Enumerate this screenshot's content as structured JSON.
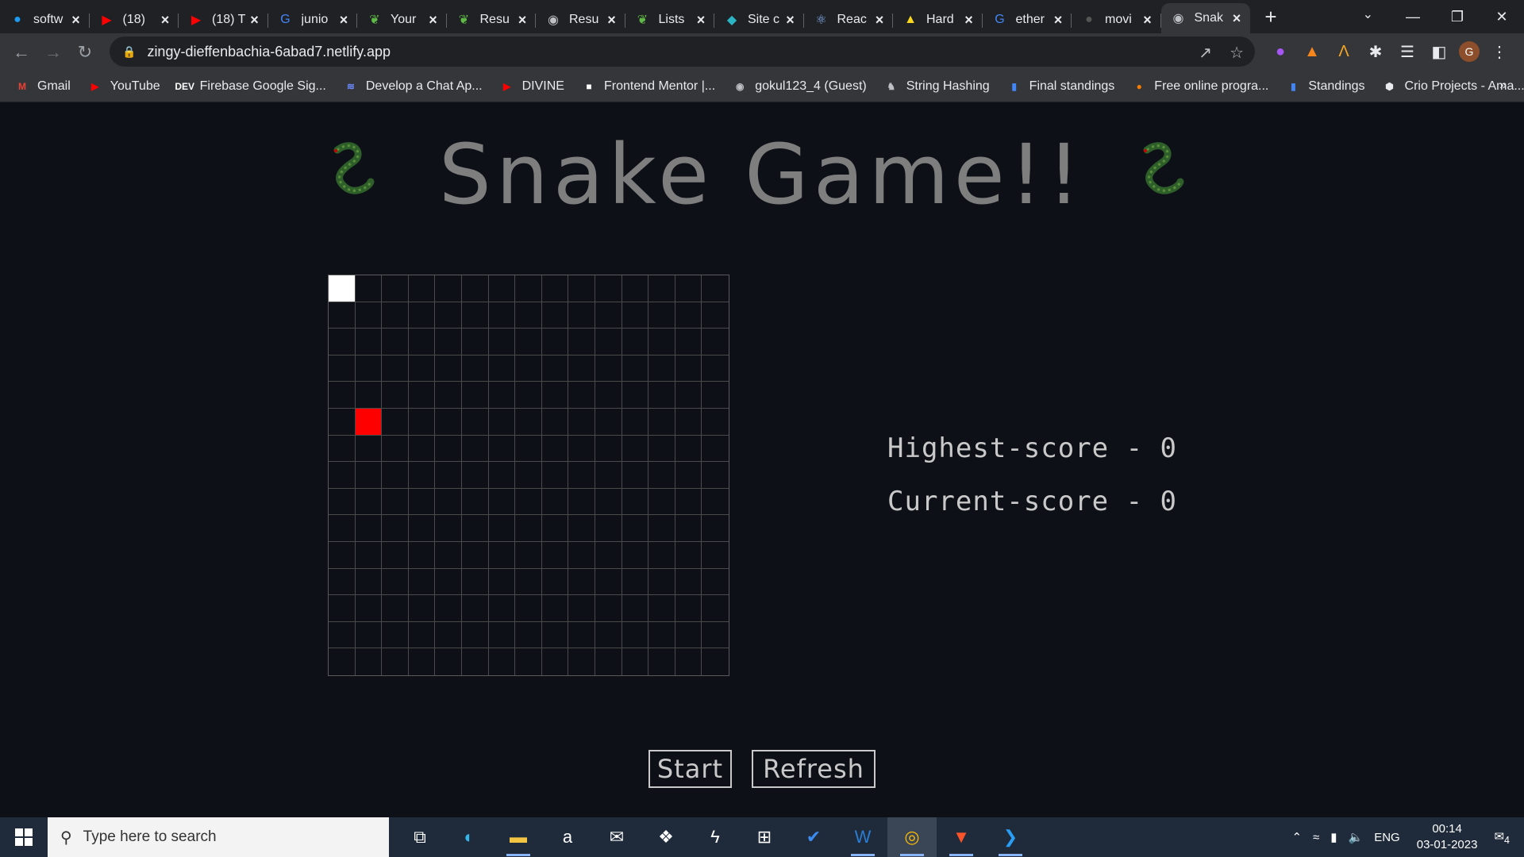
{
  "browser": {
    "tabs": [
      {
        "title": "softw",
        "icon": "twitter-icon"
      },
      {
        "title": "(18) ",
        "icon": "youtube-icon"
      },
      {
        "title": "(18) T",
        "icon": "youtube-icon"
      },
      {
        "title": "junio",
        "icon": "google-icon"
      },
      {
        "title": "Your",
        "icon": "leaf-icon"
      },
      {
        "title": "Resu",
        "icon": "leaf-icon"
      },
      {
        "title": "Resu",
        "icon": "globe-icon"
      },
      {
        "title": "Lists",
        "icon": "leaf-icon"
      },
      {
        "title": "Site c",
        "icon": "diamond-icon"
      },
      {
        "title": "Reac",
        "icon": "react-icon"
      },
      {
        "title": "Hard",
        "icon": "warning-icon"
      },
      {
        "title": "ether",
        "icon": "google-icon"
      },
      {
        "title": "movi",
        "icon": "github-icon"
      },
      {
        "title": "Snak",
        "icon": "globe-icon",
        "active": true
      }
    ],
    "url": "zingy-dieffenbachia-6abad7.netlify.app",
    "profile_initial": "G",
    "bookmarks": [
      {
        "label": "Gmail",
        "icon": "gmail-icon"
      },
      {
        "label": "YouTube",
        "icon": "youtube-icon"
      },
      {
        "label": "Firebase Google Sig...",
        "icon": "dev-icon"
      },
      {
        "label": "Develop a Chat Ap...",
        "icon": "stack-icon"
      },
      {
        "label": "DIVINE",
        "icon": "youtube-icon"
      },
      {
        "label": "Frontend Mentor |...",
        "icon": "frontend-mentor-icon"
      },
      {
        "label": "gokul123_4 (Guest)",
        "icon": "globe-icon"
      },
      {
        "label": "String Hashing",
        "icon": "owl-icon"
      },
      {
        "label": "Final standings",
        "icon": "bar-chart-icon"
      },
      {
        "label": "Free online progra...",
        "icon": "orange-circle-icon"
      },
      {
        "label": "Standings",
        "icon": "bar-chart-icon"
      },
      {
        "label": "Crio Projects - Ama...",
        "icon": "crio-icon"
      }
    ]
  },
  "game": {
    "title": "Snake Game!!",
    "grid_size": 15,
    "snake_head": {
      "row": 0,
      "col": 0
    },
    "food": {
      "row": 5,
      "col": 1
    },
    "highest_score_text": "Highest-score - 0",
    "current_score_text": "Current-score - 0",
    "start_label": "Start",
    "refresh_label": "Refresh",
    "colors": {
      "background": "#0d1117",
      "snake": "#ffffff",
      "food": "#ff0000",
      "grid": "#4a4a4a",
      "title": "#7e7e7e"
    }
  },
  "taskbar": {
    "search_placeholder": "Type here to search",
    "apps": [
      "task-view-icon",
      "edge-icon",
      "file-explorer-icon",
      "amazon-icon",
      "mail-icon",
      "dropbox-icon",
      "bolt-icon",
      "store-icon",
      "todo-icon",
      "word-icon",
      "chrome-icon",
      "brave-icon",
      "vscode-icon"
    ],
    "language": "ENG",
    "time": "00:14",
    "date": "03-01-2023",
    "notifications": "4"
  }
}
